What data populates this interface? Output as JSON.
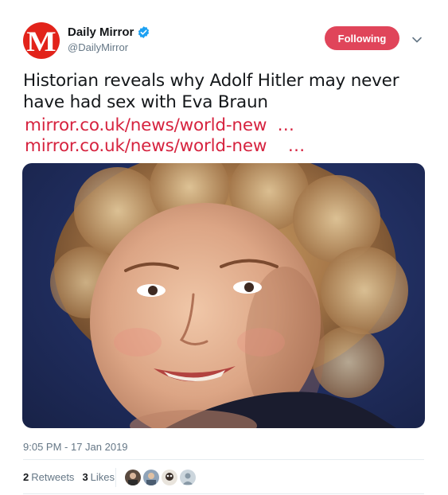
{
  "account": {
    "display_name": "Daily Mirror",
    "handle": "@DailyMirror",
    "avatar_letter": "M",
    "verified": true,
    "brand_color": "#e2231a"
  },
  "follow_button": {
    "label": "Following",
    "color": "#e0455a"
  },
  "tweet": {
    "text": "Historian reveals why Adolf Hitler may never have had sex with Eva Braun",
    "links": [
      "mirror.co.uk/news/world-new  …",
      "mirror.co.uk/news/world-new    …"
    ],
    "link_color": "#d6233f",
    "timestamp": "9:05 PM - 17 Jan 2019"
  },
  "stats": {
    "retweets_count": "2",
    "retweets_label": "Retweets",
    "likes_count": "3",
    "likes_label": "Likes"
  },
  "media": {
    "icon": "photo-of-smiling-woman"
  }
}
